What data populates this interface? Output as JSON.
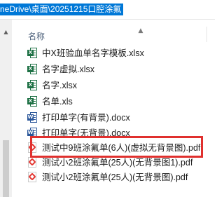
{
  "address_bar": {
    "path": "neDrive\\桌面\\20251215口腔涂氟"
  },
  "column_header": {
    "label": "名称",
    "sort_icon": "chevron-up-icon"
  },
  "files": [
    {
      "name": "中X班验血单名字模板.xlsx",
      "type": "excel"
    },
    {
      "name": "名字虚拟.xlsx",
      "type": "excel"
    },
    {
      "name": "名字.xlsx",
      "type": "excel"
    },
    {
      "name": "名单.xls",
      "type": "excel"
    },
    {
      "name": "打印单字(有背景).docx",
      "type": "word"
    },
    {
      "name": "打印单字(无背景).docx",
      "type": "word"
    },
    {
      "name": "测试中9班涂氟单(6人)(虚拟无背景图).pdf",
      "type": "pdf",
      "highlighted": true
    },
    {
      "name": "测试小2班涂氟单(25人)(无背景图1).pdf",
      "type": "pdf"
    },
    {
      "name": "测试小2班涂氟单(25人)(无背景图).pdf",
      "type": "pdf"
    }
  ],
  "colors": {
    "selection": "#0078d7",
    "highlight_box": "#e0302e",
    "excel": "#1e7145",
    "word": "#2b579a",
    "pdf": "#e3342f"
  }
}
